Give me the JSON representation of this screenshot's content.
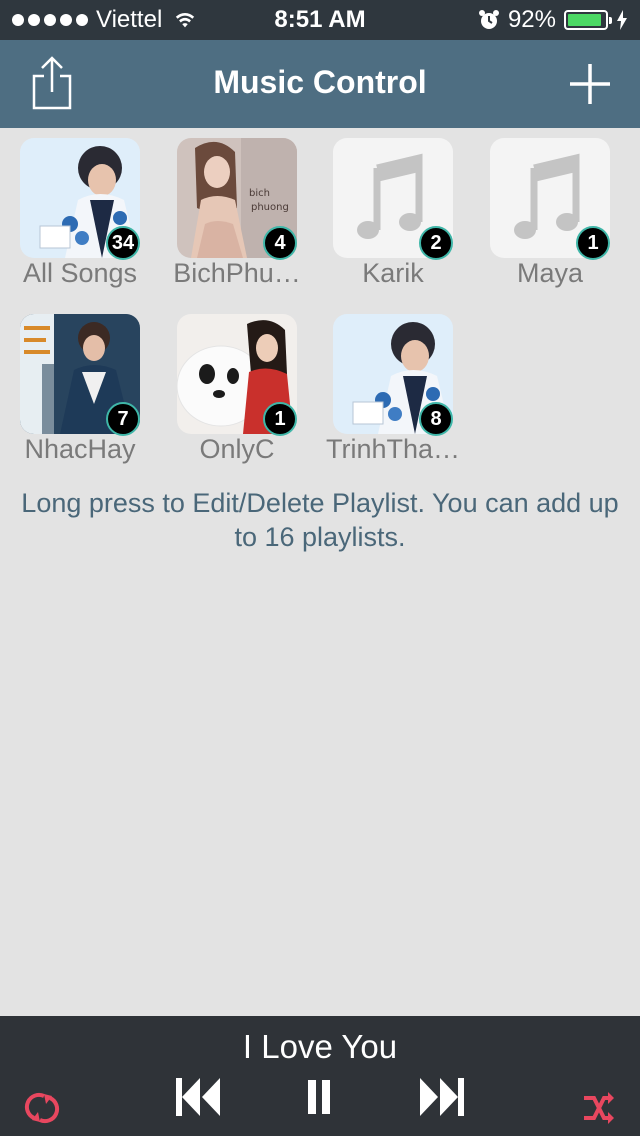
{
  "status": {
    "carrier": "Viettel",
    "time": "8:51 AM",
    "battery": "92%",
    "battery_level": 0.92
  },
  "nav": {
    "title": "Music Control",
    "share_icon": "share-icon",
    "add_icon": "plus-icon"
  },
  "playlists": [
    {
      "name": "All Songs",
      "count": "34",
      "art": "photo"
    },
    {
      "name": "BichPhu…",
      "count": "4",
      "art": "photo"
    },
    {
      "name": "Karik",
      "count": "2",
      "art": "music-note-icon"
    },
    {
      "name": "Maya",
      "count": "1",
      "art": "music-note-icon"
    },
    {
      "name": "NhacHay",
      "count": "7",
      "art": "photo"
    },
    {
      "name": "OnlyC",
      "count": "1",
      "art": "photo"
    },
    {
      "name": "TrinhTha…",
      "count": "8",
      "art": "photo"
    }
  ],
  "info_text": "Long press to Edit/Delete Playlist. You can add up to 16 playlists.",
  "player": {
    "song_title": "I Love You",
    "controls": [
      "repeat-icon",
      "previous-icon",
      "pause-icon",
      "next-icon",
      "shuffle-icon"
    ],
    "accent_color": "#e8475f"
  }
}
